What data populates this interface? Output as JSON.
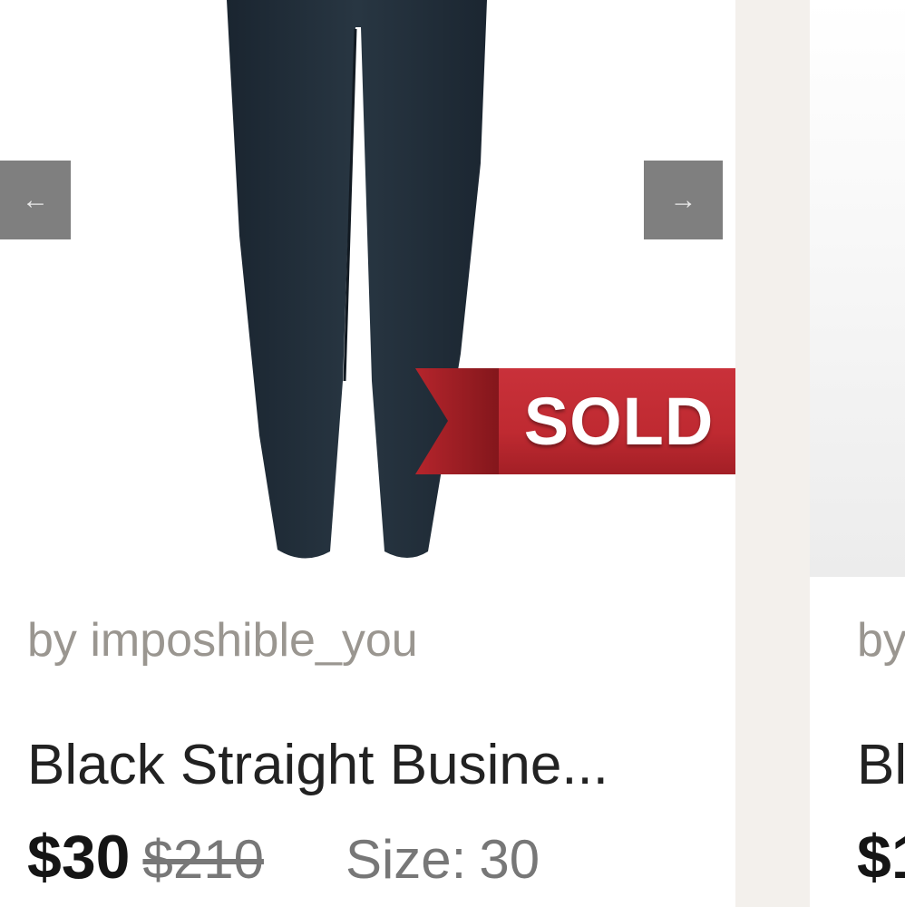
{
  "listing_1": {
    "nav_prev_glyph": "←",
    "nav_next_glyph": "→",
    "sold_label": "SOLD",
    "seller": "by imposhible_you",
    "title": "Black Straight Busine...",
    "price": "$30",
    "original_price": "$210",
    "size_label": "Size:",
    "size_value": "30"
  },
  "listing_2": {
    "seller": "by",
    "title": "Bl",
    "price": "$1"
  },
  "colors": {
    "page_background": "#f3f0ec",
    "card_background": "#ffffff",
    "sold_banner_red": "#c62a31",
    "nav_arrow_bg": "#7f7f7f",
    "seller_text": "#9a9690",
    "title_text": "#222222",
    "muted_text": "#777777"
  },
  "icons": {
    "nav_prev": "arrow-left-icon",
    "nav_next": "arrow-right-icon"
  }
}
